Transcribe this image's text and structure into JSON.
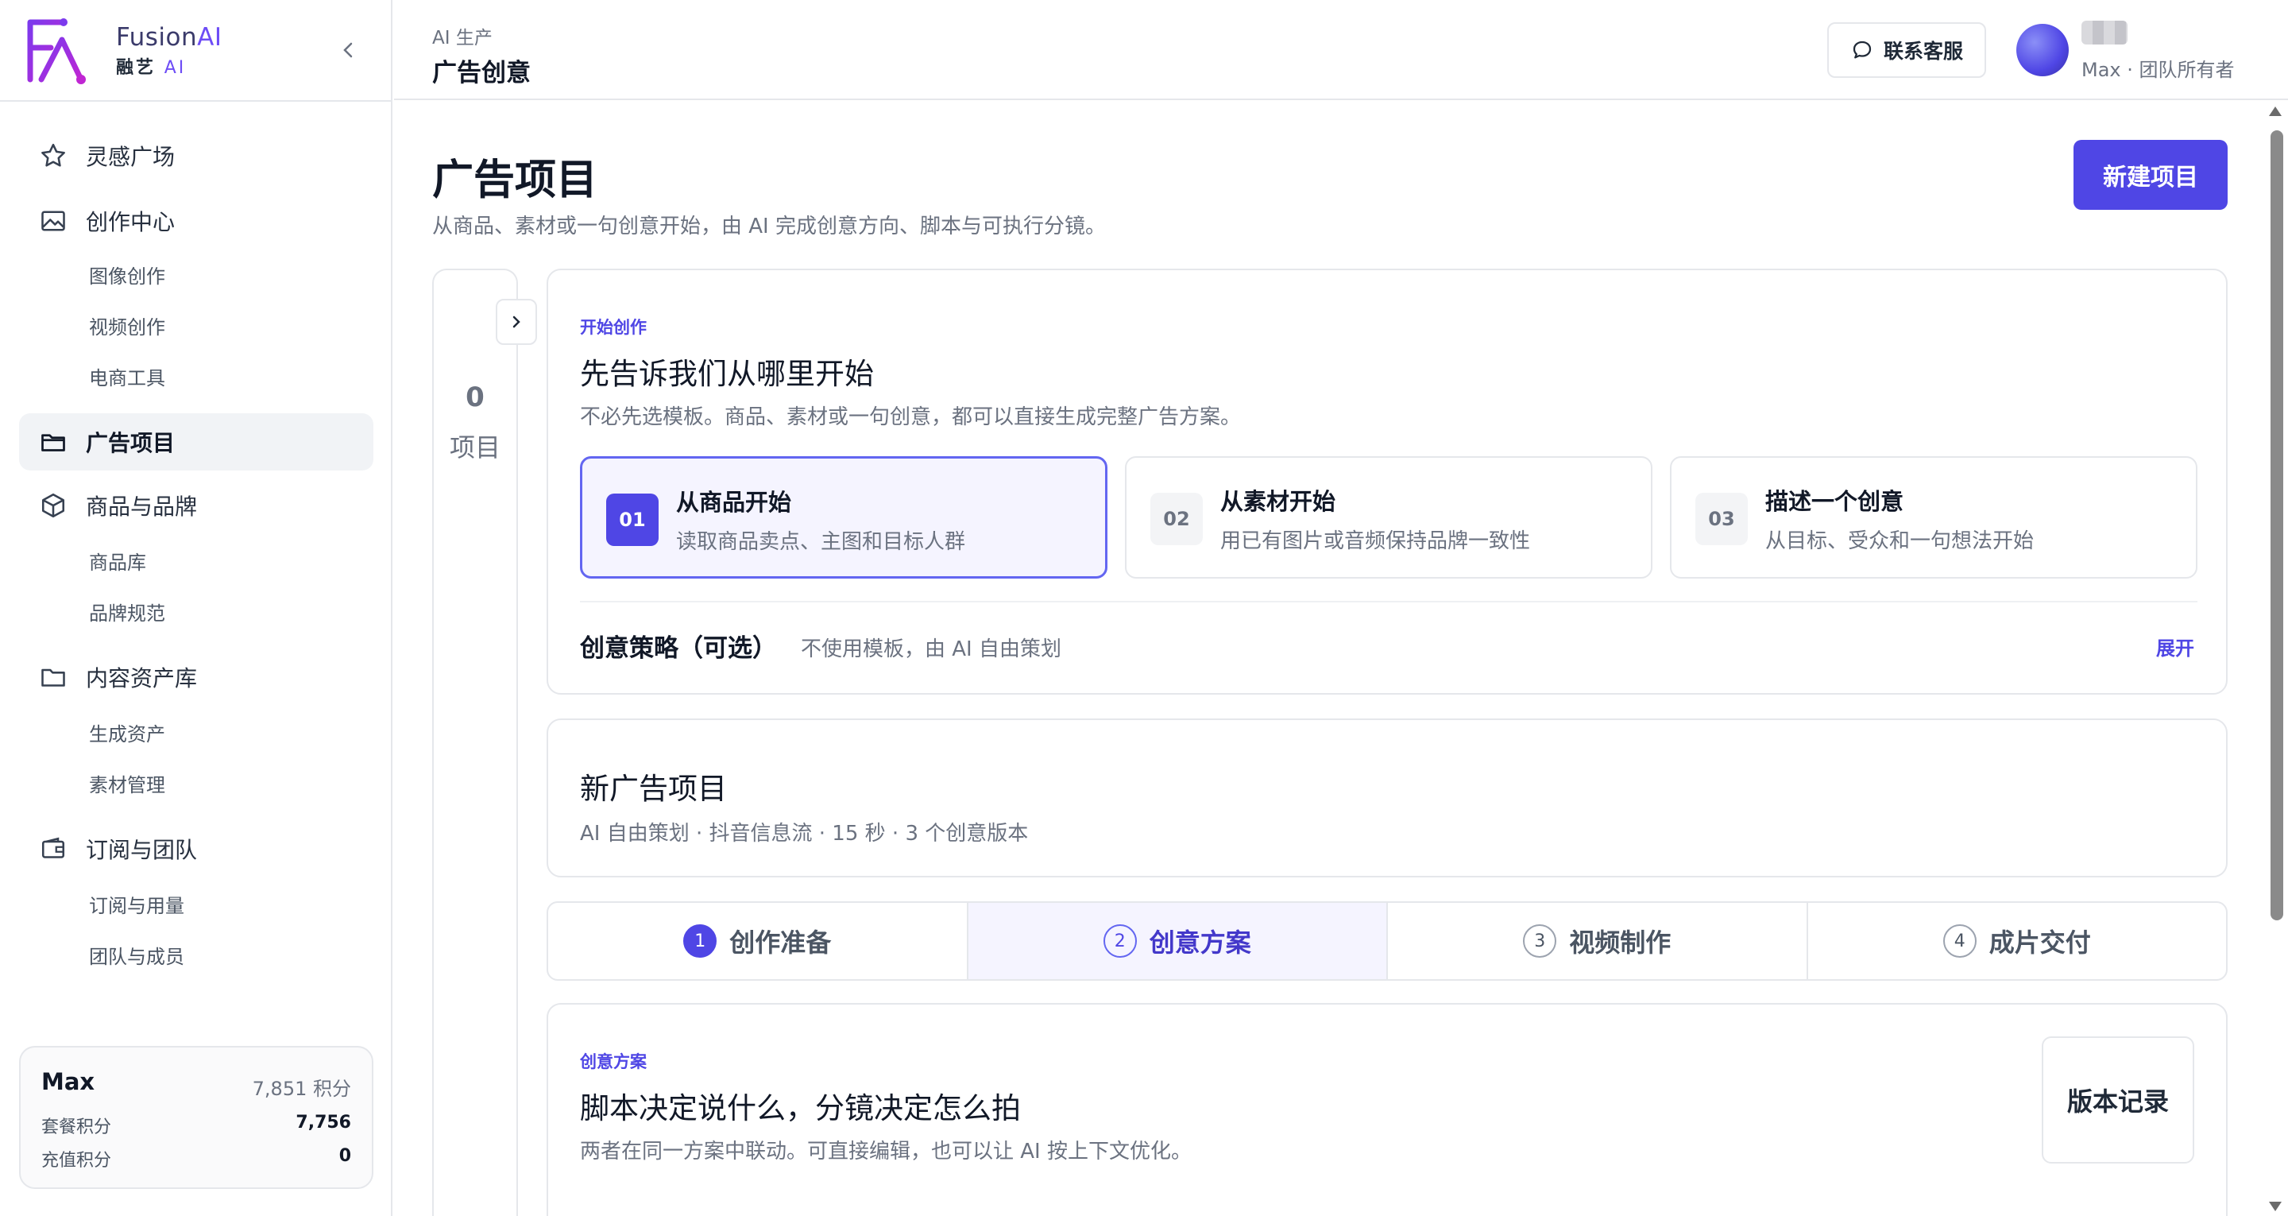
{
  "brand": {
    "name_prefix": "Fusion",
    "name_suffix": "AI",
    "sub_prefix": "融艺",
    "sub_suffix": "AI",
    "accent": "#6d4cf6"
  },
  "sidebar": {
    "nav": [
      {
        "label": "灵感广场",
        "icon": "star-icon"
      },
      {
        "label": "创作中心",
        "icon": "image-icon"
      },
      {
        "label": "图像创作"
      },
      {
        "label": "视频创作"
      },
      {
        "label": "电商工具"
      },
      {
        "label": "广告项目",
        "icon": "folder-open-icon",
        "active": true
      },
      {
        "label": "商品与品牌",
        "icon": "box-icon"
      },
      {
        "label": "商品库"
      },
      {
        "label": "品牌规范"
      },
      {
        "label": "内容资产库",
        "icon": "folder-icon"
      },
      {
        "label": "生成资产"
      },
      {
        "label": "素材管理"
      },
      {
        "label": "订阅与团队",
        "icon": "wallet-icon"
      },
      {
        "label": "订阅与用量"
      },
      {
        "label": "团队与成员"
      }
    ],
    "credits": {
      "user": "Max",
      "total": "7,851 积分",
      "plan_label": "套餐积分",
      "plan_value": "7,756",
      "topup_label": "充值积分",
      "topup_value": "0"
    }
  },
  "header": {
    "breadcrumb": "AI 生产",
    "title": "广告创意",
    "support_label": "联系客服",
    "user_role": "Max · 团队所有者"
  },
  "main": {
    "title": "广告项目",
    "description": "从商品、素材或一句创意开始，由 AI 完成创意方向、脚本与可执行分镜。",
    "new_button": "新建项目",
    "project_count": "0",
    "project_count_label": "项目",
    "start": {
      "eyebrow": "开始创作",
      "heading": "先告诉我们从哪里开始",
      "subtext": "不必先选模板。商品、素材或一句创意，都可以直接生成完整广告方案。",
      "options": [
        {
          "num": "01",
          "title": "从商品开始",
          "desc": "读取商品卖点、主图和目标人群",
          "selected": true
        },
        {
          "num": "02",
          "title": "从素材开始",
          "desc": "用已有图片或音频保持品牌一致性"
        },
        {
          "num": "03",
          "title": "描述一个创意",
          "desc": "从目标、受众和一句想法开始"
        }
      ],
      "strategy_title": "创意策略（可选）",
      "strategy_desc": "不使用模板，由 AI 自由策划",
      "strategy_toggle": "展开"
    },
    "project": {
      "title": "新广告项目",
      "meta": "AI 自由策划 · 抖音信息流 · 15 秒 · 3 个创意版本"
    },
    "steps": [
      {
        "num": "1",
        "label": "创作准备",
        "state": "done"
      },
      {
        "num": "2",
        "label": "创意方案",
        "state": "active"
      },
      {
        "num": "3",
        "label": "视频制作",
        "state": "todo"
      },
      {
        "num": "4",
        "label": "成片交付",
        "state": "todo"
      }
    ],
    "plan": {
      "eyebrow": "创意方案",
      "heading": "脚本决定说什么，分镜决定怎么拍",
      "subtext": "两者在同一方案中联动。可直接编辑，也可以让 AI 按上下文优化。",
      "version_button": "版本记录"
    }
  },
  "colors": {
    "primary": "#4f46e5",
    "selected_bg": "#f5f4ff",
    "border": "#e5e7eb"
  }
}
